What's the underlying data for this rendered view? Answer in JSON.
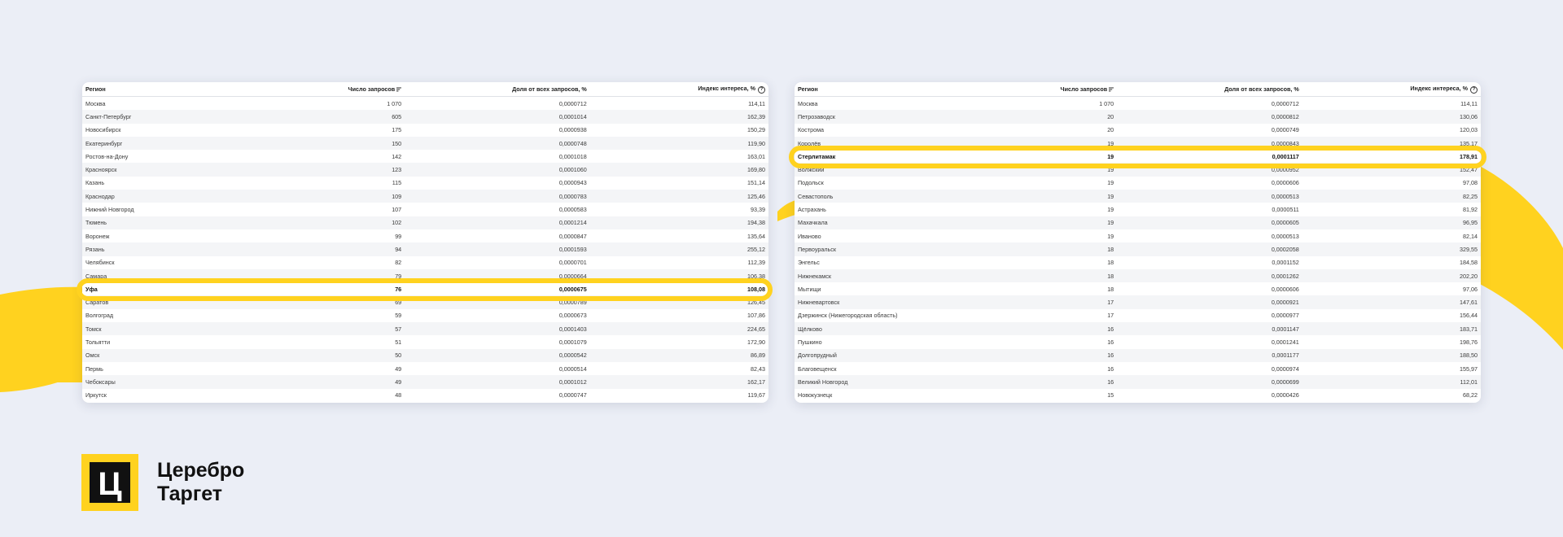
{
  "colors": {
    "accent": "#ffd21f",
    "background": "#ebeef6"
  },
  "icons": {
    "sort": "sort-lines-icon",
    "help": "question-circle-icon"
  },
  "help_glyph": "?",
  "columns": [
    "Регион",
    "Число запросов",
    "Доля от всех запросов, %",
    "Индекс интереса, %"
  ],
  "table_left": {
    "rows": [
      [
        "Москва",
        "1 070",
        "0,0000712",
        "114,11"
      ],
      [
        "Санкт-Петербург",
        "605",
        "0,0001014",
        "162,39"
      ],
      [
        "Новосибирск",
        "175",
        "0,0000938",
        "150,29"
      ],
      [
        "Екатеринбург",
        "150",
        "0,0000748",
        "119,90"
      ],
      [
        "Ростов-на-Дону",
        "142",
        "0,0001018",
        "163,01"
      ],
      [
        "Красноярск",
        "123",
        "0,0001060",
        "169,80"
      ],
      [
        "Казань",
        "115",
        "0,0000943",
        "151,14"
      ],
      [
        "Краснодар",
        "109",
        "0,0000783",
        "125,46"
      ],
      [
        "Нижний Новгород",
        "107",
        "0,0000583",
        "93,39"
      ],
      [
        "Тюмень",
        "102",
        "0,0001214",
        "194,38"
      ],
      [
        "Воронеж",
        "99",
        "0,0000847",
        "135,64"
      ],
      [
        "Рязань",
        "94",
        "0,0001593",
        "255,12"
      ],
      [
        "Челябинск",
        "82",
        "0,0000701",
        "112,39"
      ],
      [
        "Самара",
        "79",
        "0,0000664",
        "106,38"
      ],
      [
        "Уфа",
        "76",
        "0,0000675",
        "108,08"
      ],
      [
        "Саратов",
        "69",
        "0,0000789",
        "126,45"
      ],
      [
        "Волгоград",
        "59",
        "0,0000673",
        "107,86"
      ],
      [
        "Томск",
        "57",
        "0,0001403",
        "224,65"
      ],
      [
        "Тольятти",
        "51",
        "0,0001079",
        "172,90"
      ],
      [
        "Омск",
        "50",
        "0,0000542",
        "86,89"
      ],
      [
        "Пермь",
        "49",
        "0,0000514",
        "82,43"
      ],
      [
        "Чебоксары",
        "49",
        "0,0001012",
        "162,17"
      ],
      [
        "Иркутск",
        "48",
        "0,0000747",
        "119,67"
      ]
    ]
  },
  "table_right": {
    "rows": [
      [
        "Москва",
        "1 070",
        "0,0000712",
        "114,11"
      ],
      [
        "Петрозаводск",
        "20",
        "0,0000812",
        "130,06"
      ],
      [
        "Кострома",
        "20",
        "0,0000749",
        "120,03"
      ],
      [
        "Королёв",
        "19",
        "0,0000843",
        "135,17"
      ],
      [
        "Стерлитамак",
        "19",
        "0,0001117",
        "178,91"
      ],
      [
        "Волжский",
        "19",
        "0,0000952",
        "152,47"
      ],
      [
        "Подольск",
        "19",
        "0,0000606",
        "97,08"
      ],
      [
        "Севастополь",
        "19",
        "0,0000513",
        "82,25"
      ],
      [
        "Астрахань",
        "19",
        "0,0000511",
        "81,92"
      ],
      [
        "Махачкала",
        "19",
        "0,0000605",
        "96,95"
      ],
      [
        "Иваново",
        "19",
        "0,0000513",
        "82,14"
      ],
      [
        "Первоуральск",
        "18",
        "0,0002058",
        "329,55"
      ],
      [
        "Энгельс",
        "18",
        "0,0001152",
        "184,58"
      ],
      [
        "Нижнекамск",
        "18",
        "0,0001262",
        "202,20"
      ],
      [
        "Мытищи",
        "18",
        "0,0000606",
        "97,06"
      ],
      [
        "Нижневартовск",
        "17",
        "0,0000921",
        "147,61"
      ],
      [
        "Дзержинск (Нижегородская область)",
        "17",
        "0,0000977",
        "156,44"
      ],
      [
        "Щёлково",
        "16",
        "0,0001147",
        "183,71"
      ],
      [
        "Пушкино",
        "16",
        "0,0001241",
        "198,76"
      ],
      [
        "Долгопрудный",
        "16",
        "0,0001177",
        "188,50"
      ],
      [
        "Благовещенск",
        "16",
        "0,0000974",
        "155,97"
      ],
      [
        "Великий Новгород",
        "16",
        "0,0000699",
        "112,01"
      ],
      [
        "Новокузнецк",
        "15",
        "0,0000426",
        "68,22"
      ]
    ]
  },
  "logo": {
    "glyph": "Ц",
    "line1": "Церебро",
    "line2": "Таргет"
  }
}
